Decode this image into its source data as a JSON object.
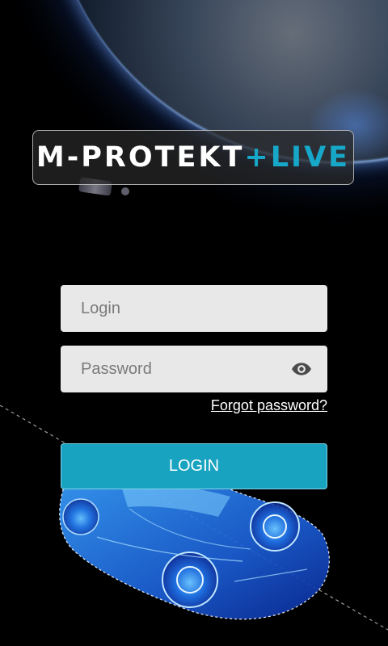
{
  "logo": {
    "brand_main": "M-PROTEKT",
    "brand_plus": "+",
    "brand_live": "LIVE"
  },
  "form": {
    "login_placeholder": "Login",
    "password_placeholder": "Password",
    "forgot_password_label": "Forgot password?",
    "login_button_label": "LOGIN"
  },
  "icons": {
    "password_toggle": "eye-icon"
  },
  "colors": {
    "accent": "#18a3c1",
    "background": "#000000",
    "input_background": "#e8e8e8"
  }
}
